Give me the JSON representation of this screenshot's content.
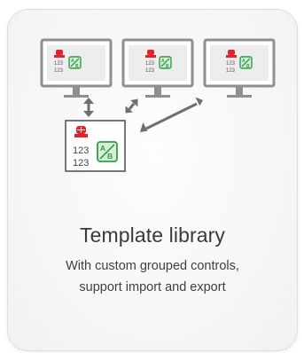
{
  "card": {
    "title": "Template library",
    "description_line1": "With custom grouped controls,",
    "description_line2": "support import and export"
  },
  "illustration": {
    "placeholder_value": "123",
    "ab_label_a": "A",
    "ab_label_b": "B",
    "colors": {
      "monitor_stroke": "#8f8f8f",
      "screen_fill": "#ededed",
      "alarm_red": "#e0232e",
      "ab_green": "#2f9e44",
      "template_box_stroke": "#555555",
      "arrow": "#6e6e6e"
    }
  }
}
